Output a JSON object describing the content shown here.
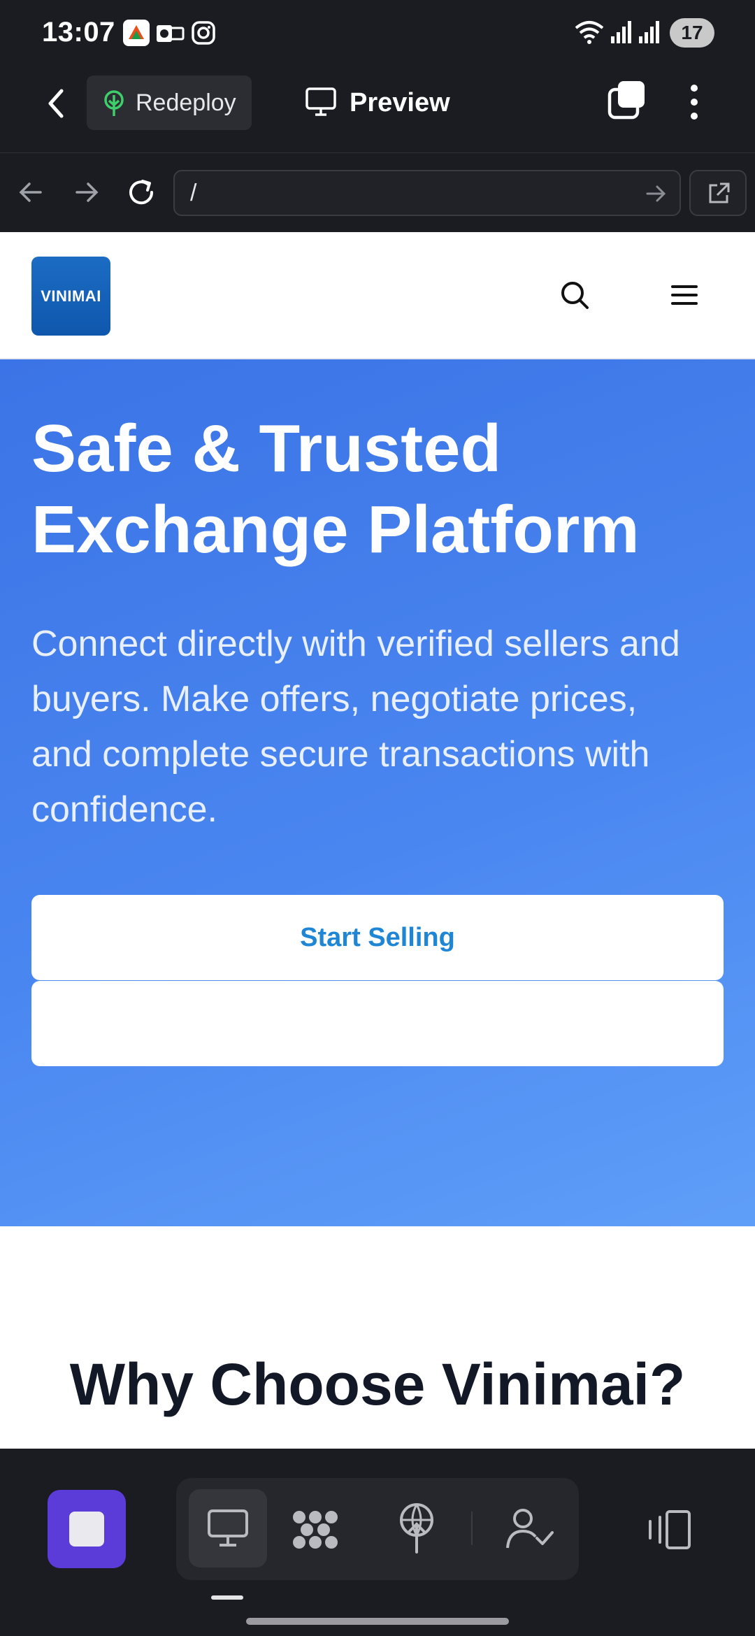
{
  "status_bar": {
    "time": "13:07",
    "battery": "17",
    "icons": [
      "artstation-app-icon",
      "outlook-app-icon",
      "instagram-app-icon",
      "wifi-icon",
      "signal-icon",
      "signal-icon"
    ]
  },
  "app_bar": {
    "redeploy_label": "Redeploy",
    "preview_label": "Preview",
    "icons": [
      "back-icon",
      "redeploy-tree-icon",
      "monitor-icon",
      "tabs-icon",
      "more-vertical-icon"
    ]
  },
  "url_bar": {
    "url": "/",
    "icons": [
      "arrow-left-icon",
      "arrow-right-icon",
      "reload-icon",
      "go-arrow-icon",
      "external-link-icon"
    ]
  },
  "site": {
    "logo_text": "VINIMAI",
    "hero_title": "Safe & Trusted Exchange Platform",
    "hero_subtitle": "Connect directly with verified sellers and buyers. Make offers, negotiate prices, and complete secure transactions with confidence.",
    "primary_button": "Start Selling",
    "secondary_button": "",
    "section_title": "Why Choose Vinimai?",
    "accent_color": "#1f86d6",
    "hero_gradient": [
      "#3b74e6",
      "#5f9ef8"
    ]
  },
  "bottom_nav": {
    "icons": [
      "stop-icon",
      "desktop-icon",
      "grid-dots-icon",
      "deploy-icon",
      "user-check-icon",
      "device-switch-icon"
    ],
    "stop_color": "#5b3cd9"
  }
}
